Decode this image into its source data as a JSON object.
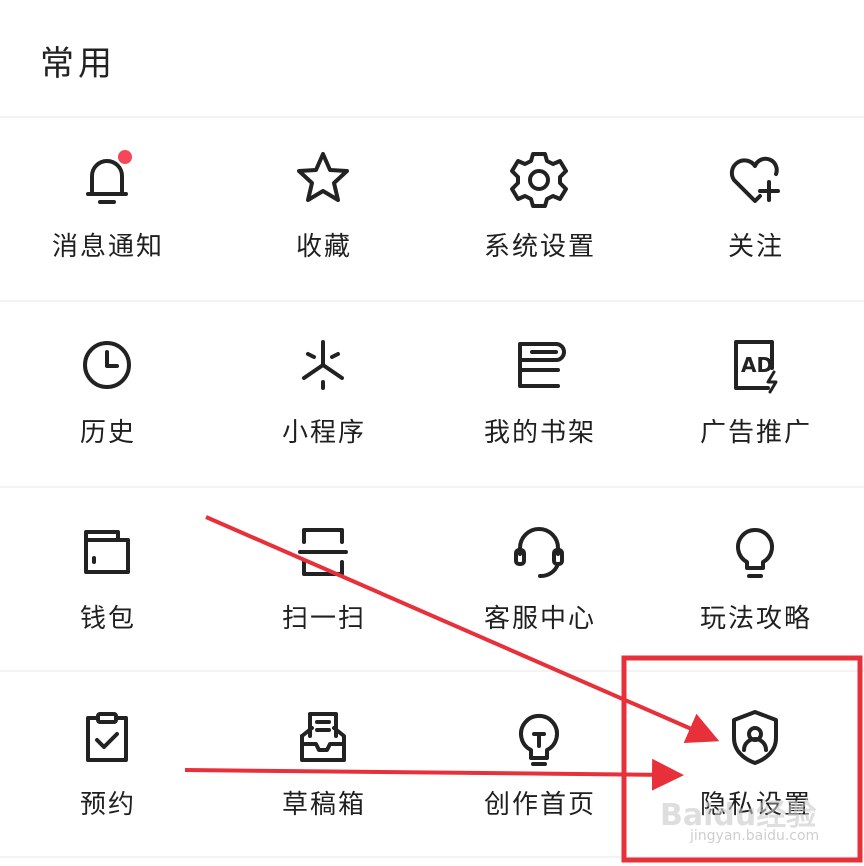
{
  "section": {
    "title": "常用"
  },
  "items": [
    {
      "label": "消息通知",
      "icon": "bell-icon",
      "badge": true
    },
    {
      "label": "收藏",
      "icon": "star-icon"
    },
    {
      "label": "系统设置",
      "icon": "gear-icon"
    },
    {
      "label": "关注",
      "icon": "heart-plus-icon"
    },
    {
      "label": "历史",
      "icon": "clock-icon"
    },
    {
      "label": "小程序",
      "icon": "mini-program-icon"
    },
    {
      "label": "我的书架",
      "icon": "bookshelf-icon"
    },
    {
      "label": "广告推广",
      "icon": "ad-icon"
    },
    {
      "label": "钱包",
      "icon": "wallet-icon"
    },
    {
      "label": "扫一扫",
      "icon": "scan-icon"
    },
    {
      "label": "客服中心",
      "icon": "headset-icon"
    },
    {
      "label": "玩法攻略",
      "icon": "lightbulb-icon"
    },
    {
      "label": "预约",
      "icon": "clipboard-check-icon"
    },
    {
      "label": "草稿箱",
      "icon": "drafts-icon"
    },
    {
      "label": "创作首页",
      "icon": "creator-bulb-icon"
    },
    {
      "label": "隐私设置",
      "icon": "shield-user-icon"
    }
  ],
  "annotation": {
    "highlight_color": "#e8303a"
  },
  "watermark": {
    "text": "Baidu经验",
    "sub": "jingyan.baidu.com"
  }
}
